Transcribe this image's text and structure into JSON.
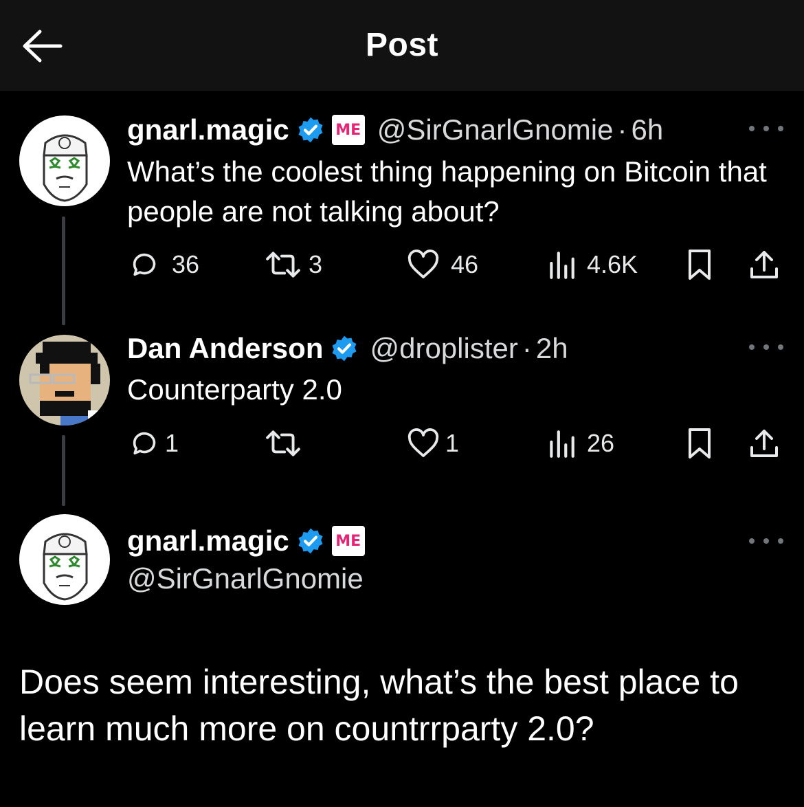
{
  "header": {
    "title": "Post"
  },
  "posts": [
    {
      "name": "gnarl.magic",
      "handle": "@SirGnarlGnomie",
      "separator": "·",
      "time": "6h",
      "affiliate_badge": "ME",
      "text": "What’s the coolest thing happening on Bitcoin that people are not talking about?",
      "replies": "36",
      "reposts": "3",
      "likes": "46",
      "views": "4.6K"
    },
    {
      "name": "Dan Anderson",
      "handle": "@droplister",
      "separator": "·",
      "time": "2h",
      "text": "Counterparty 2.0",
      "replies": "1",
      "reposts": "",
      "likes": "1",
      "views": "26"
    }
  ],
  "reply": {
    "name": "gnarl.magic",
    "handle": "@SirGnarlGnomie",
    "affiliate_badge": "ME",
    "text": "Does seem interesting, what’s the best place to learn much more on countrrparty 2.0?"
  },
  "colors": {
    "background": "#000000",
    "header_bg": "#121212",
    "verified": "#1d9bf0",
    "affiliate": "#e42575",
    "thread_line": "#3a3d41"
  },
  "icons": [
    "back-arrow-icon",
    "verified-badge-icon",
    "magic-eden-badge-icon",
    "more-icon",
    "reply-icon",
    "repost-icon",
    "like-icon",
    "views-icon",
    "bookmark-icon",
    "share-icon"
  ]
}
